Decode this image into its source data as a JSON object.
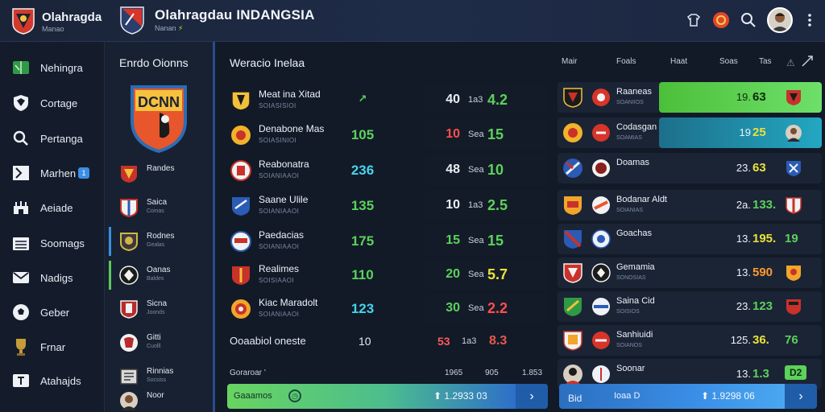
{
  "header": {
    "brand_title": "Olahragda",
    "brand_sub": "Manao",
    "title": "Olahragdau INDANGSIA",
    "sub_text": "Nanan",
    "sub_accent": "⚡"
  },
  "nav": {
    "items": [
      {
        "label": "Nehingra",
        "icon": "pitch-icon"
      },
      {
        "label": "Cortage",
        "icon": "shield-icon"
      },
      {
        "label": "Pertanga",
        "icon": "search-icon"
      },
      {
        "label": "Marhen",
        "icon": "jersey-icon",
        "badge": "1"
      },
      {
        "label": "Aeiade",
        "icon": "stadium-icon"
      },
      {
        "label": "Soomags",
        "icon": "calendar-icon"
      },
      {
        "label": "Nadigs",
        "icon": "mail-icon"
      },
      {
        "label": "Geber",
        "icon": "football-icon"
      },
      {
        "label": "Frnar",
        "icon": "trophy-icon"
      },
      {
        "label": "Atahajds",
        "icon": "scoreboard-icon"
      }
    ]
  },
  "teams": {
    "title": "Enrdo Oionns",
    "items": [
      {
        "name": "Randes",
        "sub": ""
      },
      {
        "name": "Saica",
        "sub": "Coinas"
      },
      {
        "name": "Rodnes",
        "sub": "Gealas"
      },
      {
        "name": "Oanas",
        "sub": "Baldes"
      },
      {
        "name": "Sicna",
        "sub": "Joonds"
      },
      {
        "name": "Gitti",
        "sub": "Cuolll"
      },
      {
        "name": "Rinnias",
        "sub": "Socsiss"
      },
      {
        "name": "Noor",
        "sub": ""
      }
    ]
  },
  "matches": {
    "title": "Weracio Inelaa",
    "rows": [
      {
        "name": "Meat ina Xitad",
        "sub": "SOIASISIOI",
        "value": "↗",
        "home": "40",
        "mid": "1a3",
        "away": "4.2"
      },
      {
        "name": "Denabone Mas",
        "sub": "SOIASINIOI",
        "value": "105",
        "home": "10",
        "mid": "Sea",
        "away": "15"
      },
      {
        "name": "Reabonatra",
        "sub": "SOIANIAAOI",
        "value": "236",
        "home": "48",
        "mid": "Sea",
        "away": "10"
      },
      {
        "name": "Saane Ulile",
        "sub": "SOIANIAAOI",
        "value": "135",
        "home": "10",
        "mid": "1a3",
        "away": "2.5"
      },
      {
        "name": "Paedacias",
        "sub": "SOIANIAAOI",
        "value": "175",
        "home": "15",
        "mid": "Sea",
        "away": "15"
      },
      {
        "name": "Realimes",
        "sub": "SOISIAAOI",
        "value": "110",
        "home": "20",
        "mid": "Sea",
        "away": "5.7"
      },
      {
        "name": "Kiac Maradolt",
        "sub": "SOIANIAAOI",
        "value": "123",
        "home": "30",
        "mid": "Sea",
        "away": "2.2"
      }
    ],
    "summary": {
      "label": "Ooaabiol oneste",
      "value": "10",
      "home": "53",
      "mid": "1a3",
      "away": "8.3"
    }
  },
  "footer_left": {
    "label": "Goraroar ’",
    "h1": "1965",
    "h2": "905",
    "h3": "1.853",
    "bet_label": "Gaaamos",
    "bet_total": "⬆ 1.2933 03",
    "arrow": "›"
  },
  "footer_right": {
    "label": "Bid",
    "bet_label": "Ioaa D",
    "bet_total": "⬆ 1.9298 06",
    "arrow": "›"
  },
  "odds": {
    "head": [
      "Mair",
      "Foals",
      "Haat",
      "Soas",
      "Tas",
      "⚠"
    ],
    "rows": [
      {
        "name": "Raaneas",
        "sub": "SOANIIOS",
        "o1": "19.",
        "o2": "63",
        "o3": "",
        "highlight": "green"
      },
      {
        "name": "Codasgan",
        "sub": "SOAMIAS",
        "o1": "19",
        "o2": "25",
        "o3": "",
        "highlight": "teal"
      },
      {
        "name": "Doamas",
        "sub": "",
        "o1": "23.",
        "o2": "63",
        "o3": ""
      },
      {
        "name": "Bodanar Aldt",
        "sub": "SOIANIAS",
        "o1": "2a.",
        "o2": "133.",
        "o3": ""
      },
      {
        "name": "Goachas",
        "sub": "",
        "o1": "13.",
        "o2": "195.",
        "o3": "19"
      },
      {
        "name": "Gemamia",
        "sub": "SONOSIAS",
        "o1": "13.",
        "o2": "590",
        "o3": ""
      },
      {
        "name": "Saina Cid",
        "sub": "SOISIOS",
        "o1": "23.",
        "o2": "123",
        "o3": ""
      },
      {
        "name": "Sanhiuidi",
        "sub": "SOIANOS",
        "o1": "125.",
        "o2": "36.",
        "o3": "76"
      },
      {
        "name": "Soonar",
        "sub": "",
        "o1": "13.",
        "o2": "1.3",
        "o3": "D2"
      }
    ]
  },
  "colors": {
    "bg": "#121a28",
    "green": "#5bd25a",
    "red": "#ff4d4d",
    "orange": "#ff9a2e",
    "cyan": "#46d4e8",
    "yellow": "#e8e23a",
    "blue": "#3a8ee6"
  }
}
